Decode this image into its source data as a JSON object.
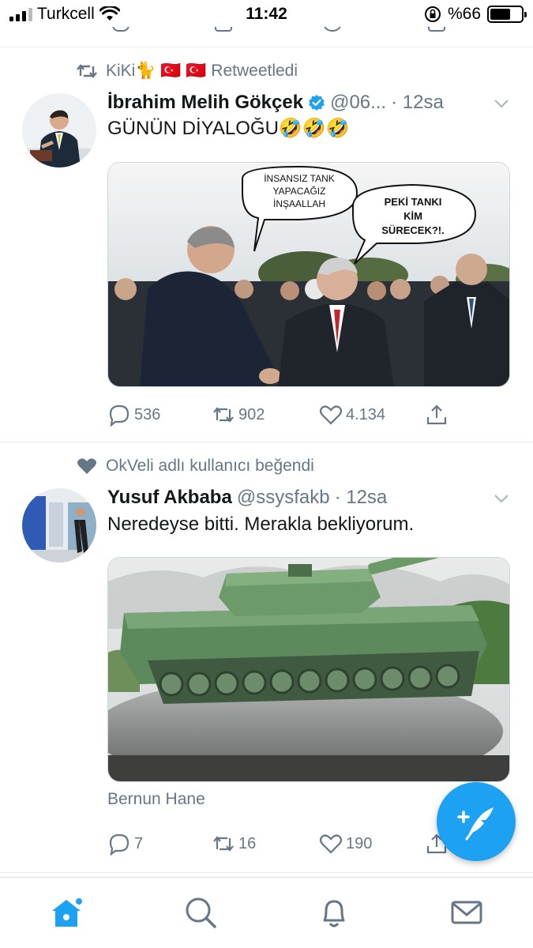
{
  "status_bar": {
    "carrier": "Turkcell",
    "time": "11:42",
    "battery_percent": "%66",
    "battery_level": 0.66
  },
  "tweets": [
    {
      "social_context": "KiKi🐈 🇹🇷 🇹🇷  Retweetledi",
      "social_icon": "retweet-icon",
      "name": "İbrahim Melih Gökçek",
      "verified": true,
      "handle": "@06...",
      "time": "· 12sa",
      "text": "GÜNÜN DİYALOĞU🤣🤣🤣",
      "image_text": {
        "bubble1": [
          "İNSANSIZ TANK",
          "YAPACAĞIZ",
          "İNŞAALLAH"
        ],
        "bubble2": [
          "PEKİ TANKI",
          "KİM",
          "SÜRECEK?!."
        ]
      },
      "actions": {
        "replies": "536",
        "retweets": "902",
        "likes": "4.134"
      }
    },
    {
      "social_context": "OkVeli adlı kullanıcı beğendi",
      "social_icon": "heart-icon",
      "name": "Yusuf Akbaba",
      "verified": false,
      "handle": "@ssysfakb",
      "time": "· 12sa",
      "text": "Neredeyse bitti. Merakla bekliyorum.",
      "media_caption": "Bernun Hane",
      "actions": {
        "replies": "7",
        "retweets": "16",
        "likes": "190"
      }
    }
  ],
  "colors": {
    "accent": "#1da1f2",
    "secondary_text": "#657786",
    "primary_text": "#14171a",
    "divider": "#e6ecf0"
  },
  "tab_bar": {
    "tabs": [
      "home-icon",
      "search-icon",
      "notifications-icon",
      "messages-icon"
    ],
    "active": "home-icon"
  }
}
